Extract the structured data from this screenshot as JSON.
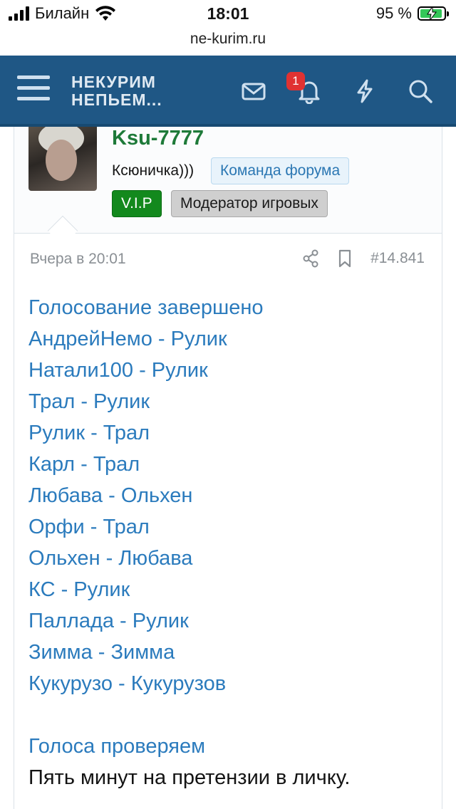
{
  "status_bar": {
    "carrier": "Билайн",
    "time": "18:01",
    "battery_percent_label": "95 %",
    "battery_level": 0.95
  },
  "browser": {
    "url": "ne-kurim.ru"
  },
  "header": {
    "logo_line1": "НЕКУРИМ",
    "logo_line2": "НЕПЬЕМ...",
    "notification_count": "1",
    "icons": [
      "menu-icon",
      "mail-icon",
      "bell-icon",
      "bolt-icon",
      "search-icon"
    ]
  },
  "post": {
    "username": "Ksu-7777",
    "user_title": "Ксюничка)))",
    "tags": {
      "team": "Команда форума",
      "vip": "V.I.P",
      "moderator": "Модератор игровых"
    },
    "timestamp": "Вчера в 20:01",
    "post_number": "#14.841",
    "lines": [
      "Голосование завершено",
      "АндрейНемо - Рулик",
      "Натали100 - Рулик",
      "Трал - Рулик",
      "Рулик - Трал",
      "Карл - Трал",
      "Любава - Ольхен",
      "Орфи - Трал",
      "Ольхен - Любава",
      "КС - Рулик",
      "Паллада - Рулик",
      "Зимма - Зимма",
      "Кукурузо - Кукурузов"
    ],
    "footer_link": "Голоса проверяем",
    "footer_text": "Пять минут на претензии в личку."
  },
  "colors": {
    "header_bg": "#1f5785",
    "link": "#2b7bbd",
    "username": "#1e7a39",
    "vip": "#13891d"
  }
}
